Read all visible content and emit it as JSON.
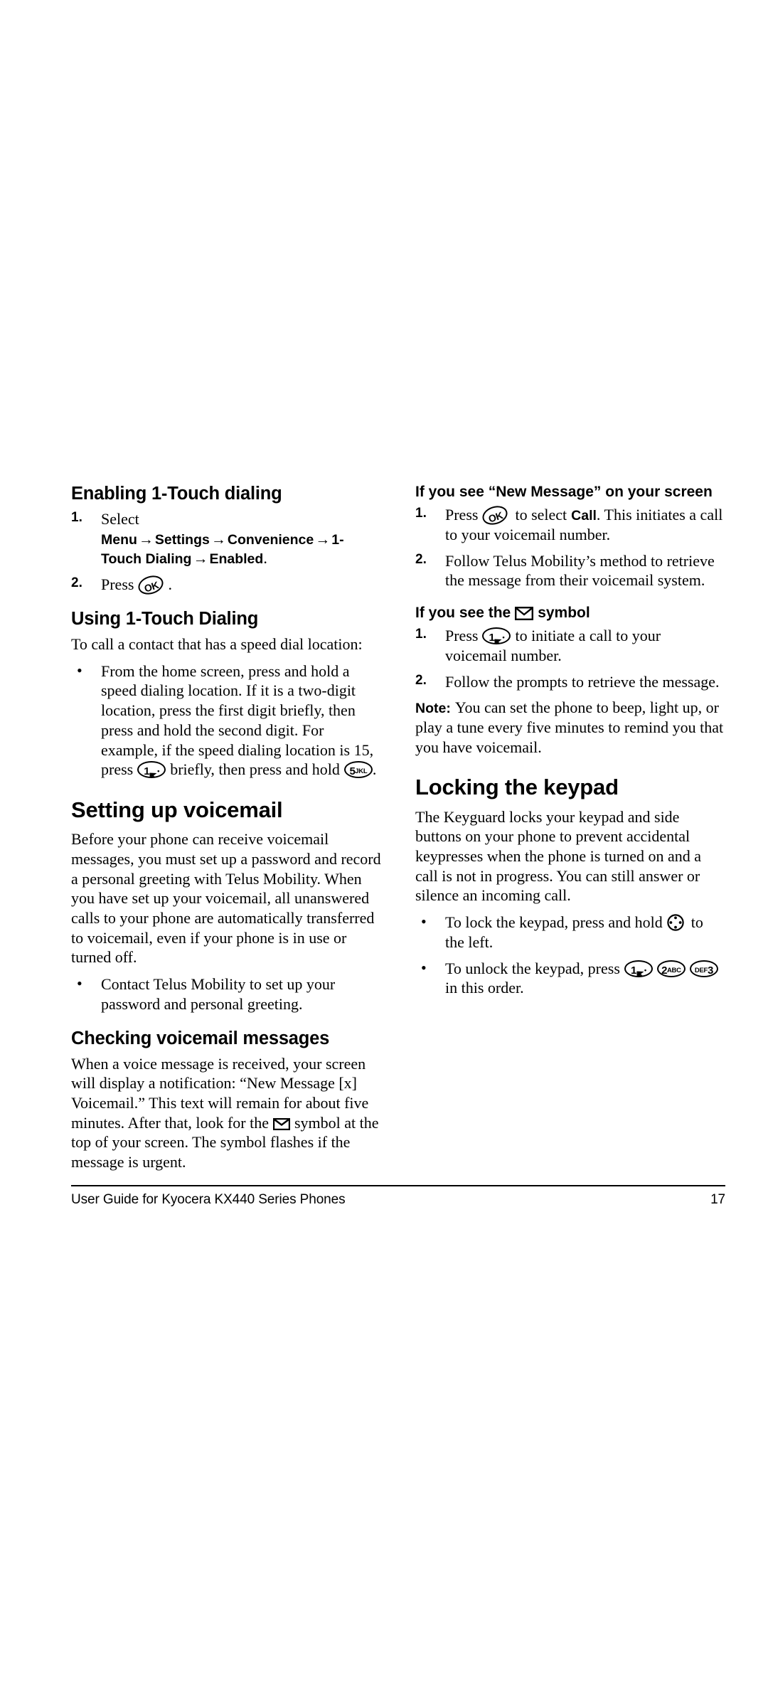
{
  "document": {
    "page_number": "17",
    "footer_text": "User Guide for Kyocera KX440 Series Phones"
  },
  "left_column": {
    "enabling": {
      "heading": "Enabling 1-Touch dialing",
      "step1": {
        "number": "1.",
        "lead": "Select",
        "menu_path": [
          "Menu",
          "Settings",
          "Convenience",
          "1-Touch Dialing",
          "Enabled"
        ],
        "arrow": "→",
        "period": "."
      },
      "step2": {
        "number": "2.",
        "lead": "Press",
        "key": "OK",
        "trailing": "."
      }
    },
    "using": {
      "heading": "Using 1-Touch Dialing",
      "intro": "To call a contact that has a speed dial location:",
      "bullet_part1": "From the home screen, press and hold a speed dialing location. If it is a two-digit location, press the first digit briefly, then press and hold the second digit. For example, if the speed dialing location is 15, press",
      "key1_digit": "1",
      "bullet_part2": "briefly, then press and hold",
      "key5_digit": "5",
      "key5_letters": "JKL",
      "bullet_part3": "."
    },
    "setting_up": {
      "heading": "Setting up voicemail",
      "paragraph": "Before your phone can receive voicemail messages, you must set up a password and record a personal greeting with Telus Mobility. When you have set up your voicemail, all unanswered calls to your phone are automatically transferred to voicemail, even if your phone is in use or turned off.",
      "bullet": "Contact Telus Mobility to set up your password and personal greeting."
    },
    "checking": {
      "heading": "Checking voicemail messages",
      "part1": "When a voice message is received, your screen will display a notification: “New Message [x] Voicemail.” This text will remain for about five minutes. After that, look for the",
      "part2": "symbol at the top of your screen. The symbol flashes if the message is urgent."
    }
  },
  "right_column": {
    "new_message": {
      "heading": "If you see “New Message” on your screen",
      "step1": {
        "number": "1.",
        "lead": "Press",
        "key": "OK",
        "mid": "to select",
        "bold_word": "Call",
        "tail": ". This initiates a call to your voicemail number."
      },
      "step2": {
        "number": "2.",
        "text": "Follow Telus Mobility’s method to retrieve the message from their voicemail system."
      }
    },
    "envelope_symbol": {
      "heading_part1": "If you see the",
      "heading_part2": "symbol",
      "step1": {
        "number": "1.",
        "lead": "Press",
        "key_digit": "1",
        "tail": "to initiate a call to your voicemail number."
      },
      "step2": {
        "number": "2.",
        "text": "Follow the prompts to retrieve the message."
      },
      "note": {
        "label": "Note:",
        "text": "You can set the phone to beep, light up, or play a tune every five minutes to remind you that you have voicemail."
      }
    },
    "locking": {
      "heading": "Locking the keypad",
      "paragraph": "The Keyguard locks your keypad and side buttons on your phone to prevent accidental keypresses when the phone is turned on and a call is not in progress. You can still answer or silence an incoming call.",
      "bullet1_part1": "To lock the keypad, press and hold",
      "bullet1_part2": "to the left.",
      "bullet2_part1": "To unlock the keypad, press",
      "bullet2_part2": "in this order.",
      "keys": [
        {
          "digit": "1",
          "letters": "",
          "voicemail": true
        },
        {
          "digit": "2",
          "letters": "ABC",
          "voicemail": false
        },
        {
          "digit": "3",
          "letters": "DEF",
          "voicemail": false,
          "letters_first": true
        }
      ]
    }
  },
  "icons": {
    "ok_key": "ok-key-icon",
    "one_voicemail_key": "one-voicemail-key-icon",
    "five_jkl_key": "five-jkl-key-icon",
    "two_abc_key": "two-abc-key-icon",
    "def_three_key": "def-three-key-icon",
    "navigation_key": "navigation-key-icon",
    "envelope": "envelope-icon"
  },
  "colors": {
    "text": "#000000",
    "background": "#ffffff"
  }
}
